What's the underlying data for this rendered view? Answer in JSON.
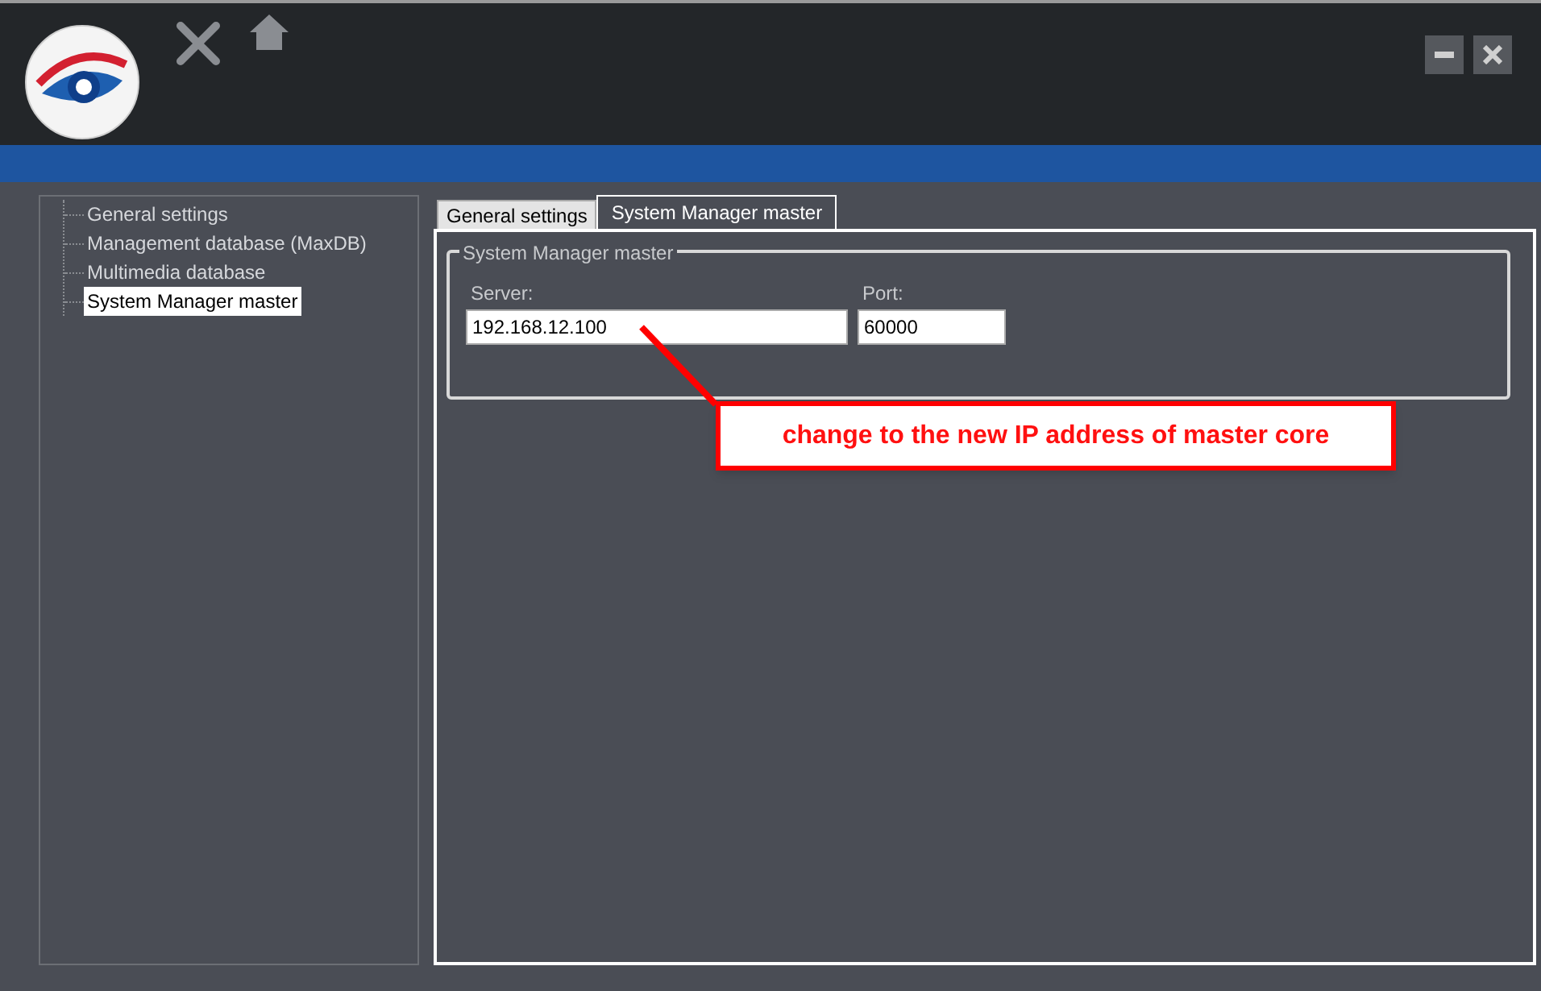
{
  "tree": {
    "items": [
      {
        "label": "General settings",
        "selected": false
      },
      {
        "label": "Management database (MaxDB)",
        "selected": false
      },
      {
        "label": "Multimedia database",
        "selected": false
      },
      {
        "label": "System Manager master",
        "selected": true
      }
    ]
  },
  "tabs": [
    {
      "label": "General settings",
      "selected": false
    },
    {
      "label": "System Manager master",
      "selected": true
    }
  ],
  "group": {
    "title": "System Manager master",
    "fields": [
      {
        "label": "Server:",
        "value": "192.168.12.100",
        "kind": "wide"
      },
      {
        "label": "Port:",
        "value": "60000",
        "kind": "narrow"
      }
    ]
  },
  "callout": {
    "text": "change to the new IP address of master core"
  }
}
